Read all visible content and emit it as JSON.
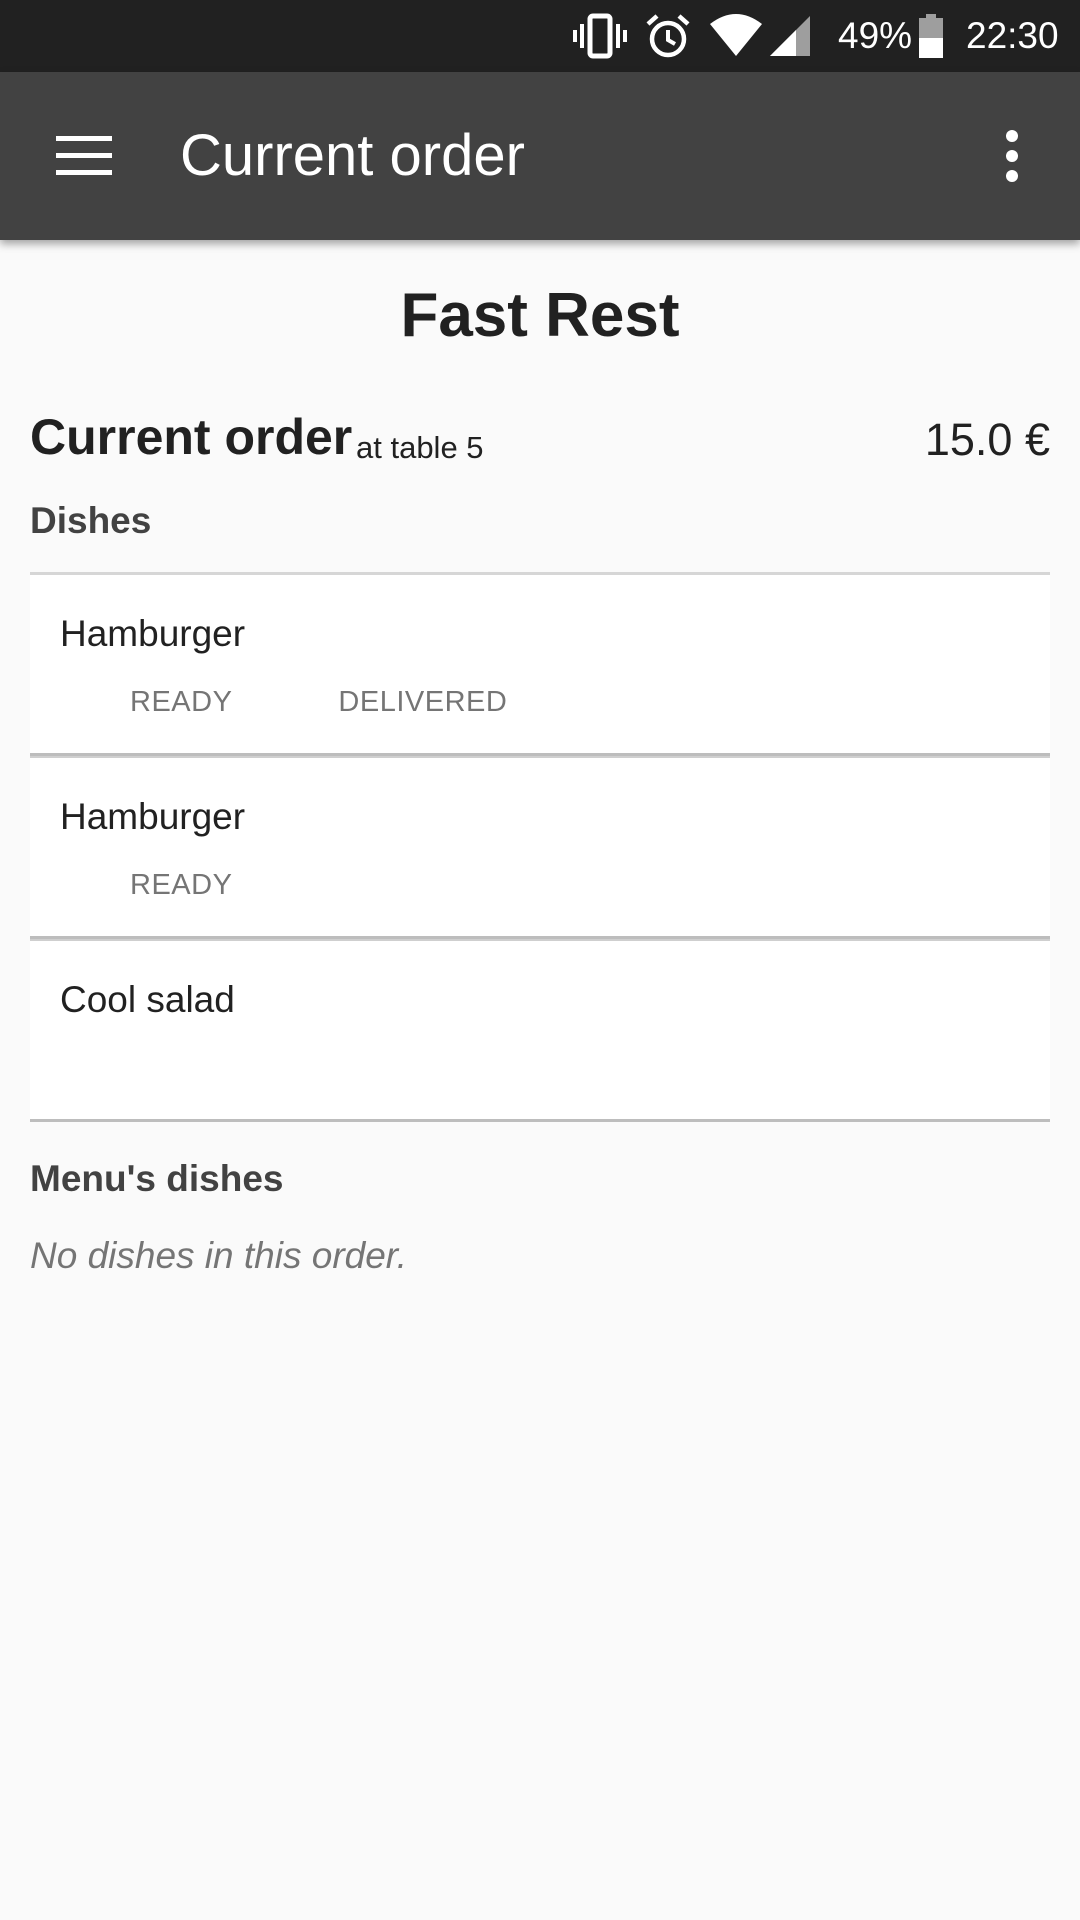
{
  "status_bar": {
    "icons": [
      "vibrate-icon",
      "alarm-icon",
      "wifi-icon",
      "signal-icon",
      "battery-icon"
    ],
    "battery": "49%",
    "time": "22:30"
  },
  "app_bar": {
    "title": "Current order",
    "menu_icon": "hamburger-menu-icon",
    "overflow_icon": "more-vert-icon",
    "background": "#424242"
  },
  "restaurant_name": "Fast Rest",
  "order": {
    "title": "Current order",
    "table": "at table 5",
    "total": "15.0 €"
  },
  "dishes_section": {
    "label": "Dishes",
    "items": [
      {
        "name": "Hamburger",
        "actions": [
          "READY",
          "DELIVERED"
        ]
      },
      {
        "name": "Hamburger",
        "actions": [
          "READY"
        ]
      },
      {
        "name": "Cool salad",
        "actions": []
      }
    ]
  },
  "menu_section": {
    "label": "Menu's dishes",
    "empty_message": "No dishes in this order."
  }
}
